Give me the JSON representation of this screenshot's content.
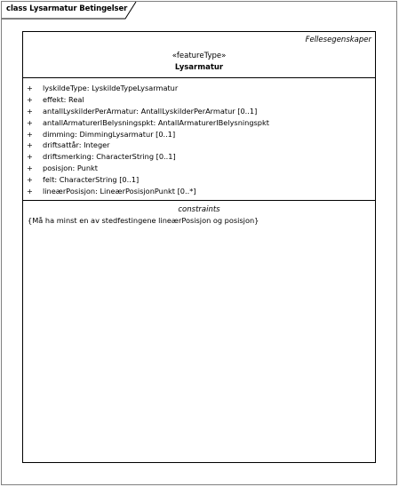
{
  "diagram": {
    "frame_title": "class Lysarmatur Betingelser"
  },
  "class": {
    "package": "Fellesegenskaper",
    "stereotype": "«featureType»",
    "name": "Lysarmatur",
    "attributes": [
      {
        "visibility": "+",
        "text": "lyskildeType: LyskildeTypeLysarmatur"
      },
      {
        "visibility": "+",
        "text": "effekt: Real"
      },
      {
        "visibility": "+",
        "text": "antallLyskilderPerArmatur: AntallLyskilderPerArmatur [0..1]"
      },
      {
        "visibility": "+",
        "text": "antallArmaturerIBelysningspkt: AntallArmaturerIBelysningspkt"
      },
      {
        "visibility": "+",
        "text": "dimming: DimmingLysarmatur [0..1]"
      },
      {
        "visibility": "+",
        "text": "driftsattår: Integer"
      },
      {
        "visibility": "+",
        "text": "driftsmerking: CharacterString [0..1]"
      },
      {
        "visibility": "+",
        "text": "posisjon: Punkt"
      },
      {
        "visibility": "+",
        "text": "felt: CharacterString [0..1]"
      },
      {
        "visibility": "+",
        "text": "lineærPosisjon: LineærPosisjonPunkt [0..*]"
      }
    ],
    "constraints_header": "constraints",
    "constraints": [
      "{Må ha minst en av stedfestingene lineærPosisjon og posisjon}"
    ]
  },
  "colors": {
    "frame_border": "#7f7f7f",
    "box_border": "#000000",
    "background": "#ffffff"
  }
}
